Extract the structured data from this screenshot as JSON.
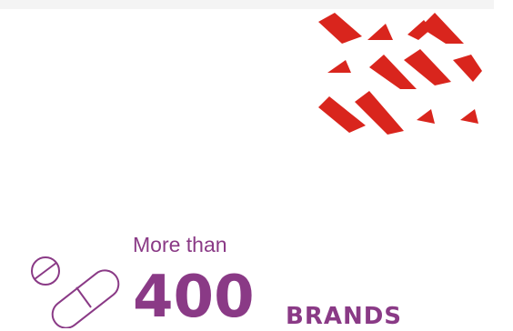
{
  "colors": {
    "accent": "#8a3a86",
    "pattern_red": "#d9251d",
    "band": "#f4f4f4"
  },
  "icons": {
    "pattern": "red-triangle-pattern",
    "pill": "pill-capsule-icon"
  },
  "stat": {
    "lead": "More than",
    "value": "400",
    "unit": "BRANDS"
  }
}
